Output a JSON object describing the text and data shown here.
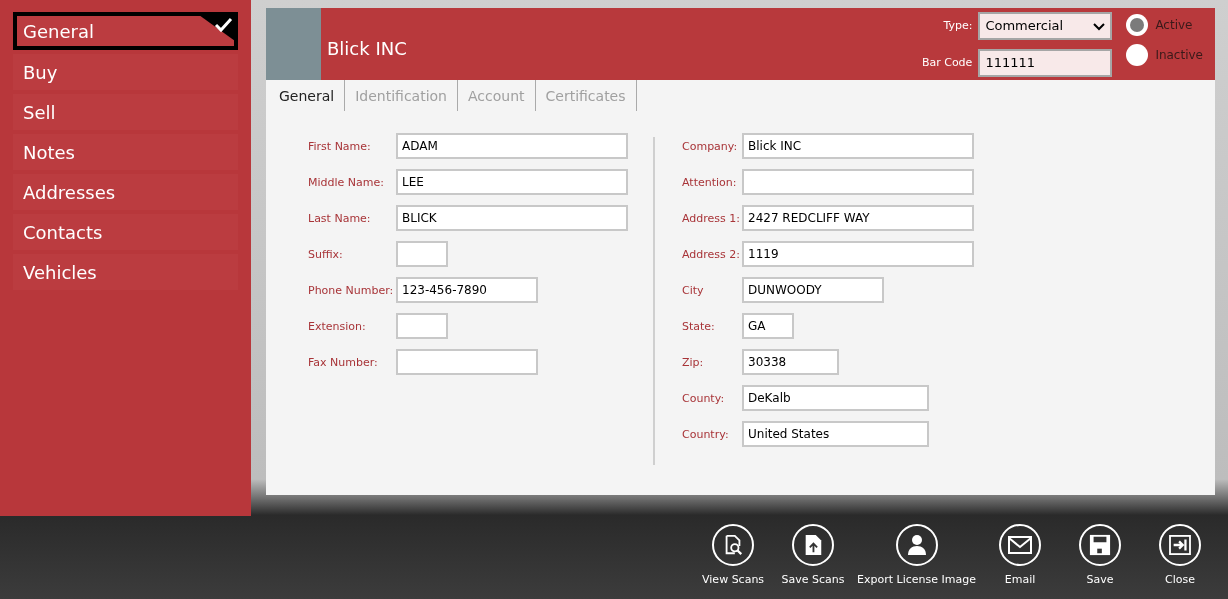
{
  "sidebar": {
    "items": [
      {
        "label": "General",
        "selected": true
      },
      {
        "label": "Buy",
        "selected": false
      },
      {
        "label": "Sell",
        "selected": false
      },
      {
        "label": "Notes",
        "selected": false
      },
      {
        "label": "Addresses",
        "selected": false
      },
      {
        "label": "Contacts",
        "selected": false
      },
      {
        "label": "Vehicles",
        "selected": false
      }
    ]
  },
  "header": {
    "name": "Blick INC",
    "type_label": "Type:",
    "type_value": "Commercial",
    "barcode_label": "Bar Code",
    "barcode_value": "111111",
    "status": [
      {
        "label": "Active",
        "selected": true
      },
      {
        "label": "Inactive",
        "selected": false
      }
    ]
  },
  "tabs": [
    {
      "label": "General",
      "selected": true
    },
    {
      "label": "Identification",
      "selected": false
    },
    {
      "label": "Account",
      "selected": false
    },
    {
      "label": "Certificates",
      "selected": false
    }
  ],
  "left_fields": [
    {
      "label": "First Name:",
      "value": "ADAM"
    },
    {
      "label": "Middle Name:",
      "value": "LEE"
    },
    {
      "label": "Last Name:",
      "value": "BLICK"
    },
    {
      "label": "Suffix:"
    },
    {
      "label": "Phone Number:",
      "value": "123-456-7890"
    },
    {
      "label": "Extension:"
    },
    {
      "label": "Fax Number:"
    }
  ],
  "right_fields": [
    {
      "label": "Company:",
      "value": "Blick INC"
    },
    {
      "label": "Attention:"
    },
    {
      "label": "Address 1:",
      "value": "2427 REDCLIFF WAY"
    },
    {
      "label": "Address 2:",
      "value": "1119"
    },
    {
      "label": "City",
      "value": "DUNWOODY"
    },
    {
      "label": "State:",
      "value": "GA"
    },
    {
      "label": "Zip:",
      "value": "30338"
    },
    {
      "label": "County:",
      "value": "DeKalb"
    },
    {
      "label": "Country:",
      "value": "United States"
    }
  ],
  "toolbar": [
    {
      "label": "View Scans"
    },
    {
      "label": "Save Scans"
    },
    {
      "label": "Export License Image"
    },
    {
      "label": "Email"
    },
    {
      "label": "Save"
    },
    {
      "label": "Close"
    }
  ]
}
